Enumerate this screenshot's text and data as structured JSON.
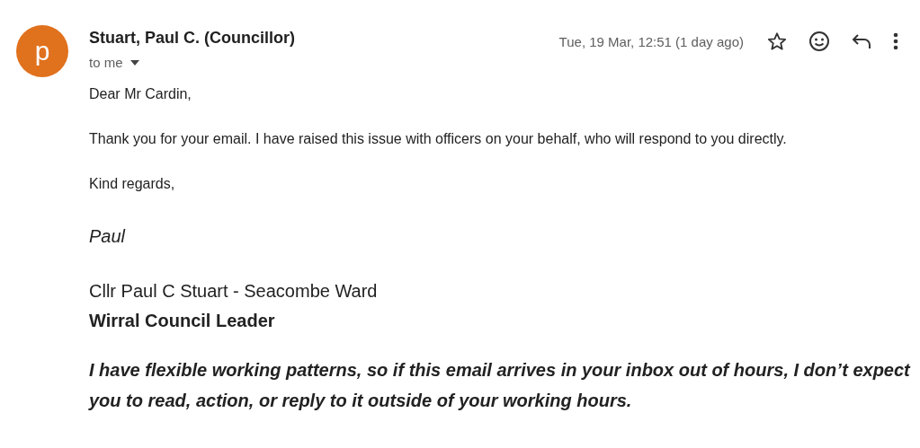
{
  "sender": {
    "avatar_letter": "p",
    "name": "Stuart, Paul C. (Councillor)",
    "recipient": "to me"
  },
  "date": "Tue, 19 Mar, 12:51 (1 day ago)",
  "starred": false,
  "body": {
    "greeting": "Dear Mr Cardin,",
    "paragraphs": [
      "Thank you for your email. I have raised this issue with officers on your behalf, who will respond to you directly."
    ],
    "closing": "Kind regards,",
    "signature_name": "Paul",
    "signature_line": "Cllr Paul C Stuart - Seacombe Ward",
    "signature_title": "Wirral Council Leader",
    "disclaimer": "I have flexible working patterns, so if this email arrives in your inbox out of hours, I don’t expect you to read, action, or reply to it outside of your working hours."
  }
}
